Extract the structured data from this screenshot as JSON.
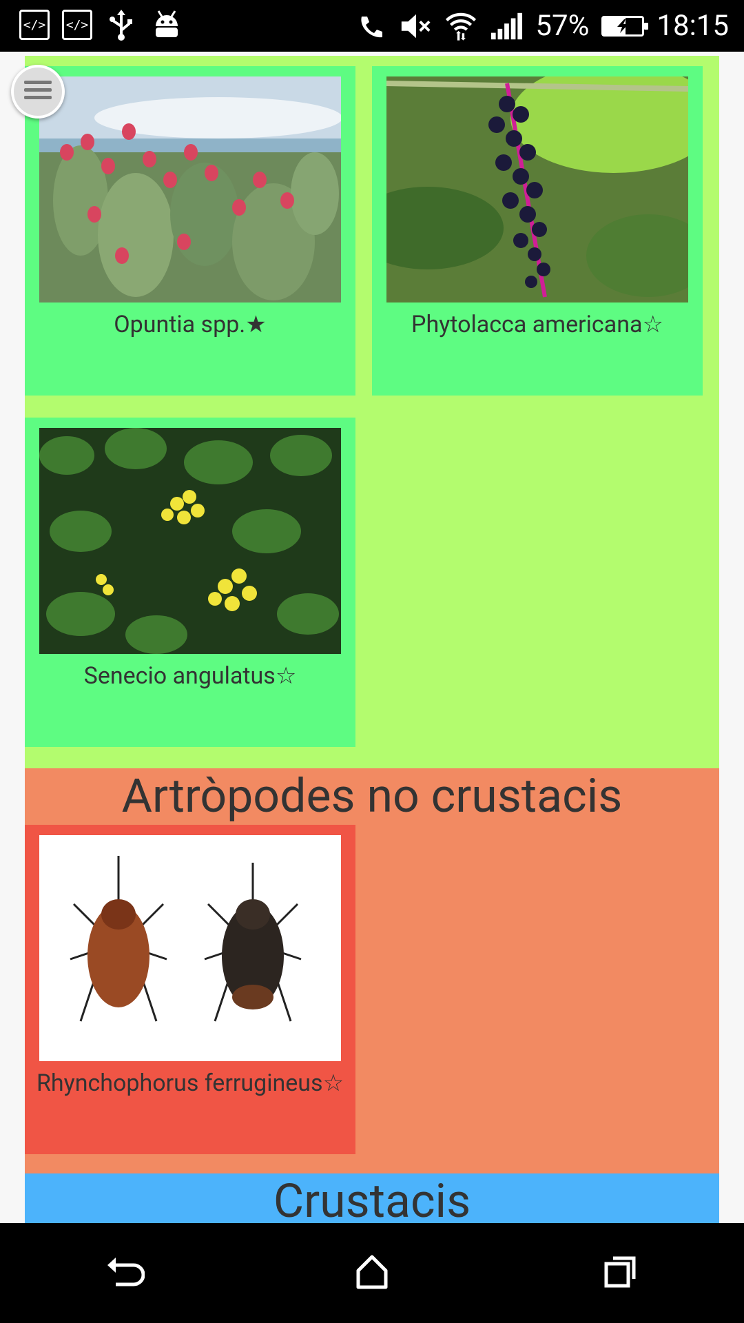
{
  "status_bar": {
    "left_icons": [
      "code-icon",
      "code-icon",
      "usb-icon",
      "android-icon"
    ],
    "right_icons": [
      "phone-icon",
      "mute-icon",
      "wifi-icon",
      "signal-icon"
    ],
    "code_glyph": "</>",
    "battery_percent": "57%",
    "battery_level": 0.57,
    "time": "18:15"
  },
  "sections": {
    "plants": {
      "color": "#b3fc6e",
      "cards": [
        {
          "name": "Opuntia spp.",
          "star": "★",
          "card_color": "#5efc82"
        },
        {
          "name": "Phytolacca americana",
          "star": "☆",
          "card_color": "#5efc82"
        },
        {
          "name": "Senecio angulatus",
          "star": "☆",
          "card_color": "#5efc82"
        }
      ]
    },
    "arthropods": {
      "title": "Artròpodes no crustacis",
      "color": "#f28a62",
      "cards": [
        {
          "name": "Rhynchophorus ferrugineus",
          "star": "☆",
          "card_color": "#f05545"
        }
      ]
    },
    "crustaceans": {
      "title": "Crustacis",
      "color": "#4cb3fb"
    }
  },
  "menu_button": {
    "icon": "menu-icon"
  },
  "nav_bar": {
    "icons": [
      "back-icon",
      "home-icon",
      "recents-icon"
    ]
  }
}
